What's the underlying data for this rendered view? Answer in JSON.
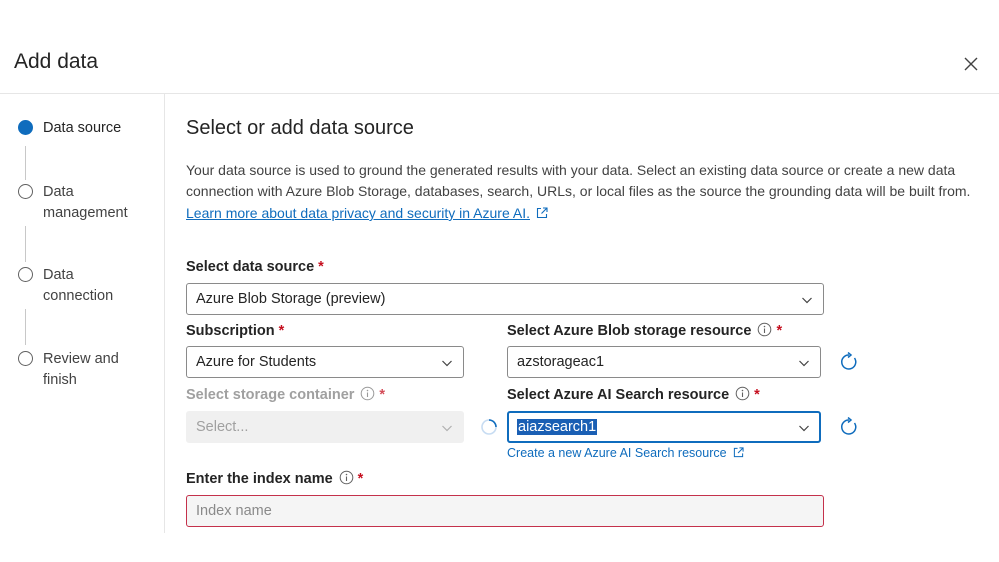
{
  "dialog": {
    "title": "Add data"
  },
  "steps": [
    {
      "label": "Data source",
      "active": true
    },
    {
      "label": "Data management",
      "active": false
    },
    {
      "label": "Data connection",
      "active": false
    },
    {
      "label": "Review and finish",
      "active": false
    }
  ],
  "main": {
    "title": "Select or add data source",
    "description": "Your data source is used to ground the generated results with your data. Select an existing data source or create a new data connection with Azure Blob Storage, databases, search, URLs, or local files as the source the grounding data will be built from.",
    "learn_link": "Learn more about data privacy and security in Azure AI."
  },
  "fields": {
    "data_source": {
      "label": "Select data source",
      "required": "*",
      "value": "Azure Blob Storage (preview)"
    },
    "subscription": {
      "label": "Subscription",
      "required": "*",
      "value": "Azure for Students"
    },
    "blob_resource": {
      "label": "Select Azure Blob storage resource",
      "required": "*",
      "value": "azstorageac1"
    },
    "storage_container": {
      "label": "Select storage container",
      "required": "*",
      "value": "Select..."
    },
    "search_resource": {
      "label": "Select Azure AI Search resource",
      "required": "*",
      "value": "aiazsearch1",
      "create_link": "Create a new Azure AI Search resource"
    },
    "index_name": {
      "label": "Enter the index name",
      "required": "*",
      "placeholder": "Index name",
      "value": ""
    }
  },
  "colors": {
    "accent": "#0f6cbd",
    "required": "#c50f1f",
    "error_border": "#c4314b"
  }
}
